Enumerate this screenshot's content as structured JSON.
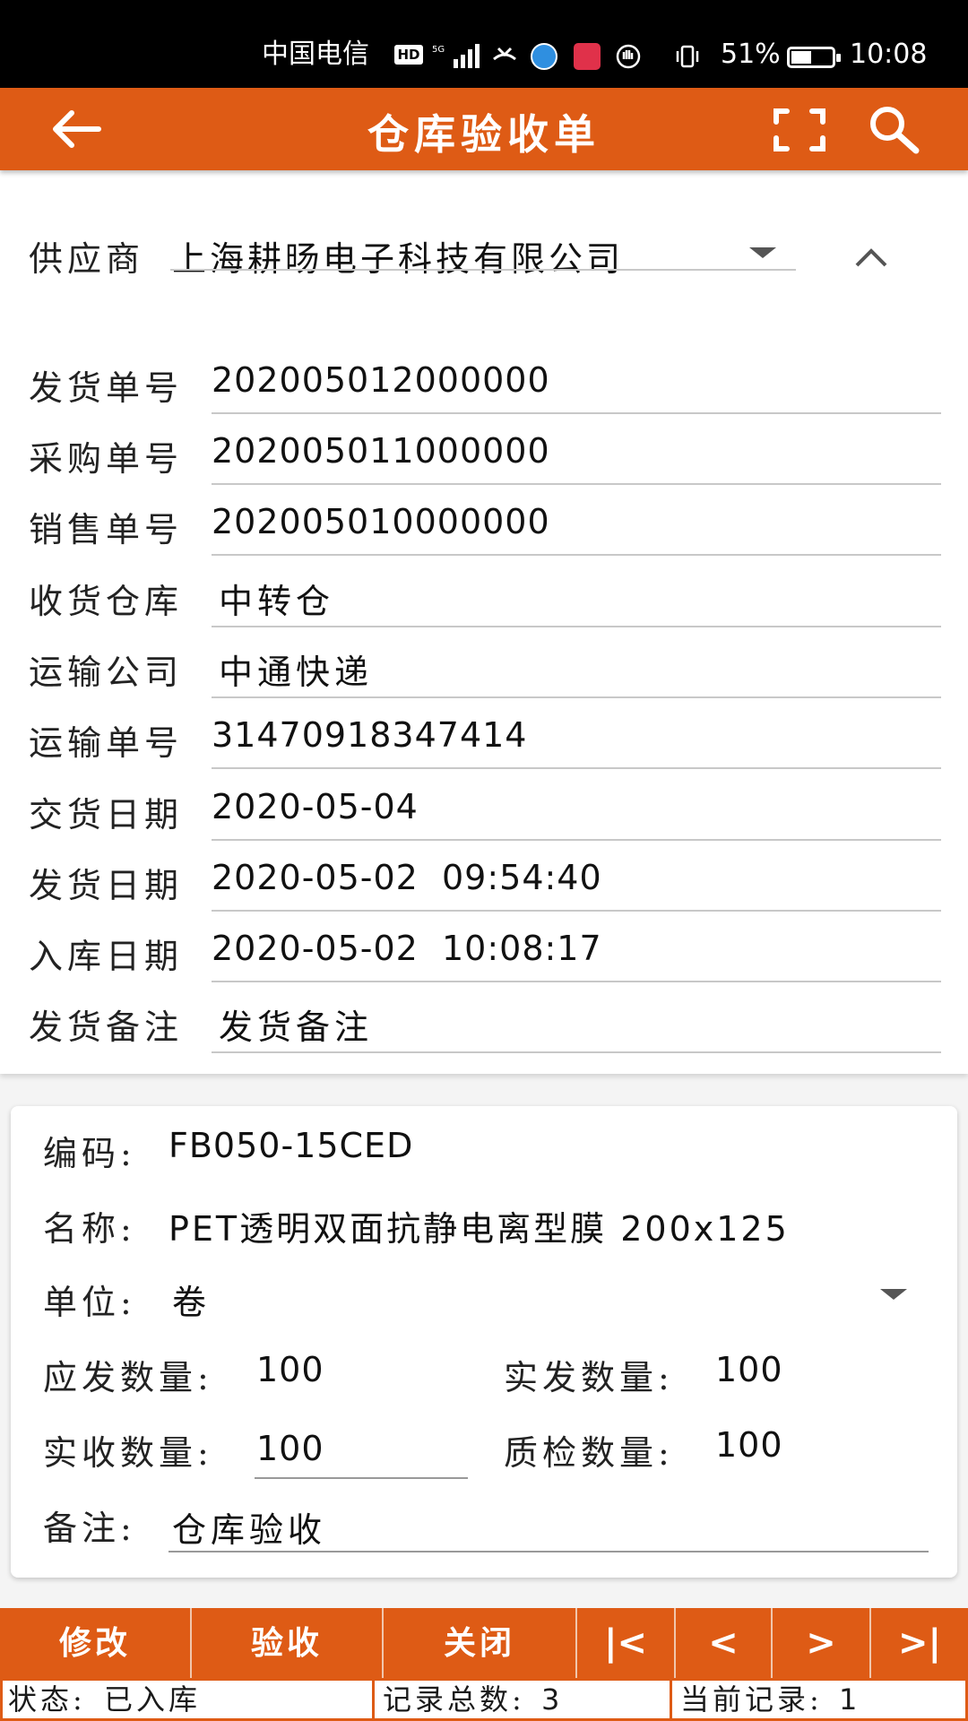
{
  "status_bar": {
    "carrier": "中国电信",
    "hd": "HD",
    "battery_percent": "51%",
    "time": "10:08"
  },
  "app_bar": {
    "title": "仓库验收单"
  },
  "header": {
    "supplier_label": "供应商",
    "supplier_value": "上海耕旸电子科技有限公司",
    "fields": [
      {
        "label": "发货单号",
        "value": "202005012000000"
      },
      {
        "label": "采购单号",
        "value": "202005011000000"
      },
      {
        "label": "销售单号",
        "value": "202005010000000"
      },
      {
        "label": "收货仓库",
        "value": "中转仓"
      },
      {
        "label": "运输公司",
        "value": "中通快递"
      },
      {
        "label": "运输单号",
        "value": "31470918347414"
      },
      {
        "label": "交货日期",
        "value": "2020-05-04"
      },
      {
        "label": "发货日期",
        "value": "2020-05-02  09:54:40"
      },
      {
        "label": "入库日期",
        "value": "2020-05-02  10:08:17"
      },
      {
        "label": "发货备注",
        "value": "发货备注"
      }
    ]
  },
  "item": {
    "code_label": "编码:",
    "code_value": "FB050-15CED",
    "name_label": "名称:",
    "name_value": "PET透明双面抗静电离型膜 200x125",
    "unit_label": "单位:",
    "unit_value": "卷",
    "due_qty_label": "应发数量:",
    "due_qty_value": "100",
    "shipped_qty_label": "实发数量:",
    "shipped_qty_value": "100",
    "received_qty_label": "实收数量:",
    "received_qty_value": "100",
    "qc_qty_label": "质检数量:",
    "qc_qty_value": "100",
    "remark_label": "备注:",
    "remark_value": "仓库验收"
  },
  "toolbar": {
    "edit": "修改",
    "accept": "验收",
    "close": "关闭",
    "first": "|<",
    "prev": "<",
    "next": ">",
    "last": ">|"
  },
  "footer": {
    "status_label": "状态:",
    "status_value": "已入库",
    "total_label": "记录总数:",
    "total_value": "3",
    "current_label": "当前记录:",
    "current_value": "1"
  },
  "colors": {
    "accent": "#de5b15"
  }
}
